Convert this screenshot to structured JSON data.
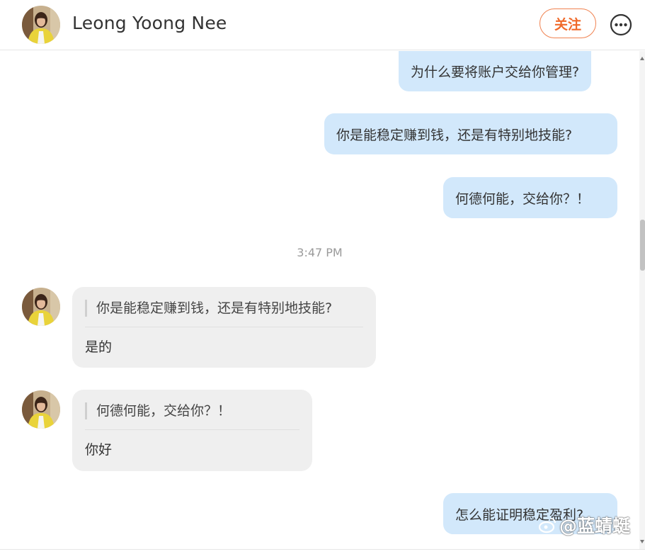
{
  "header": {
    "contact_name": "Leong Yoong Nee",
    "follow_label": "关注",
    "more_icon": "more-options-icon"
  },
  "colors": {
    "outgoing_bubble": "#d2e8fb",
    "incoming_bubble": "#efefef",
    "follow_accent": "#f06a2a"
  },
  "messages": {
    "out_1": "为什么要将账户交给你管理?",
    "out_2": "你是能稳定赚到钱，还是有特别地技能?",
    "out_3": "何德何能，交给你？！",
    "timestamp": "3:47 PM",
    "in_1": {
      "quote": "你是能稳定赚到钱，还是有特别地技能?",
      "reply": "是的"
    },
    "in_2": {
      "quote": "何德何能，交给你？！",
      "reply": "你好"
    },
    "out_4": "怎么能证明稳定盈利?"
  },
  "watermark": {
    "text": "@蓝蜻蜓"
  }
}
